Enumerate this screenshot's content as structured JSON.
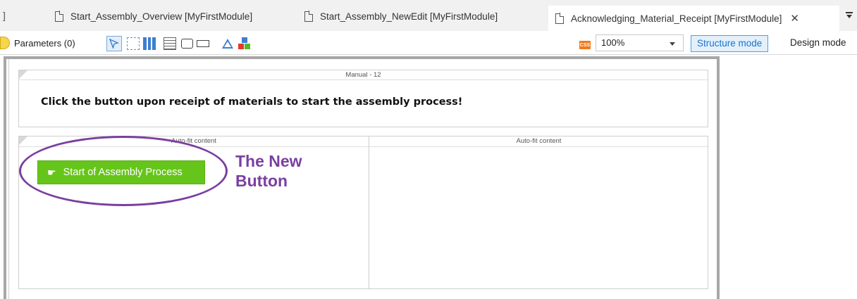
{
  "tabs": {
    "truncated_fragment": "]",
    "items": [
      {
        "label": "Start_Assembly_Overview [MyFirstModule]",
        "active": false
      },
      {
        "label": "Start_Assembly_NewEdit [MyFirstModule]",
        "active": false
      },
      {
        "label": "Acknowledging_Material_Receipt [MyFirstModule]",
        "active": true
      }
    ],
    "close_glyph": "✕"
  },
  "toolbar": {
    "parameters_label": "Parameters (0)",
    "css_badge": "CSS",
    "zoom_value": "100%",
    "structure_mode_label": "Structure mode",
    "design_mode_label": "Design mode",
    "icons": [
      "select-pointer-icon",
      "container-icon",
      "layout-grid-icon",
      "data-grid-icon",
      "rectangle-icon",
      "wide-rectangle-icon",
      "shape-icon",
      "building-blocks-icon",
      "overflow-menu-icon"
    ]
  },
  "canvas": {
    "manual_header": "Manual - 12",
    "instruction_text": "Click the button upon receipt of materials to start the assembly process!",
    "left_column_header": "Auto-fit content",
    "right_column_header": "Auto-fit content",
    "button_icon": "☛",
    "button_label": "Start of Assembly Process",
    "button_color": "#66c51a"
  },
  "annotation": {
    "line1": "The New",
    "line2": "Button",
    "color": "#7a3fa0"
  }
}
